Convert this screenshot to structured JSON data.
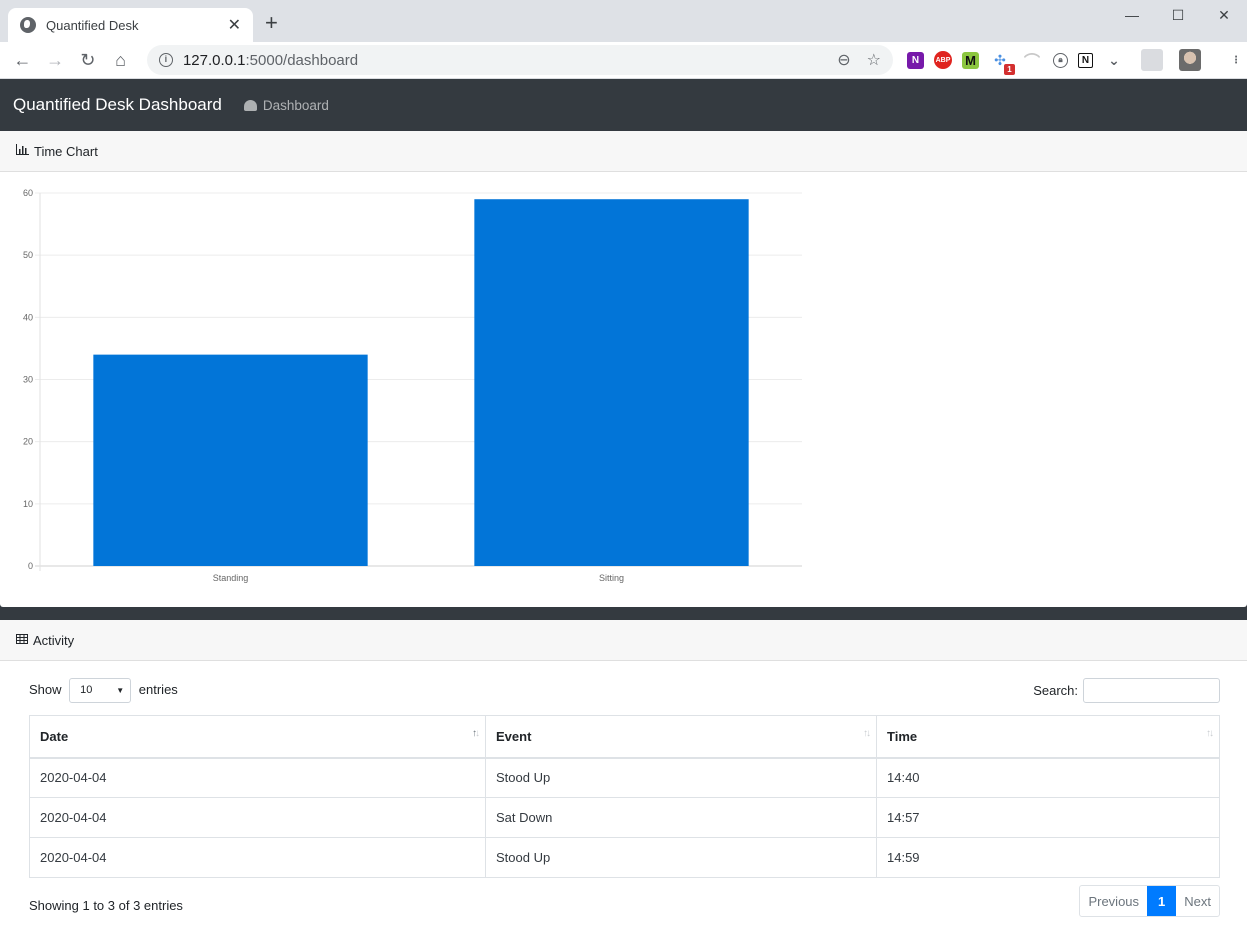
{
  "browser": {
    "tab_title": "Quantified Desk",
    "url_host": "127.0.0.1",
    "url_rest": ":5000/dashboard",
    "extensions": [
      "onenote",
      "adblock-plus",
      "m-extension",
      "network-extension",
      "arc-extension",
      "password-extension",
      "notion",
      "pocket"
    ],
    "extension_badge": "1",
    "labels": {
      "onenote": "N",
      "abp": "ABP",
      "m": "M",
      "notion": "N"
    }
  },
  "navbar": {
    "brand": "Quantified Desk Dashboard",
    "link": "Dashboard"
  },
  "time_chart": {
    "header": "Time Chart"
  },
  "chart_data": {
    "type": "bar",
    "title": "",
    "categories": [
      "Standing",
      "Sitting"
    ],
    "values": [
      34,
      59
    ],
    "xlabel": "",
    "ylabel": "",
    "ylim": [
      0,
      60
    ],
    "yticks": [
      0,
      10,
      20,
      30,
      40,
      50,
      60
    ],
    "grid": true,
    "legend": "none",
    "color": "#0275d8"
  },
  "activity": {
    "header": "Activity",
    "show_label": "Show",
    "entries_label": "entries",
    "length_value": "10",
    "search_label": "Search:",
    "search_value": "",
    "columns": [
      "Date",
      "Event",
      "Time"
    ],
    "rows": [
      [
        "2020-04-04",
        "Stood Up",
        "14:40"
      ],
      [
        "2020-04-04",
        "Sat Down",
        "14:57"
      ],
      [
        "2020-04-04",
        "Stood Up",
        "14:59"
      ]
    ],
    "info": "Showing 1 to 3 of 3 entries",
    "pagination": {
      "previous": "Previous",
      "current": "1",
      "next": "Next"
    }
  }
}
